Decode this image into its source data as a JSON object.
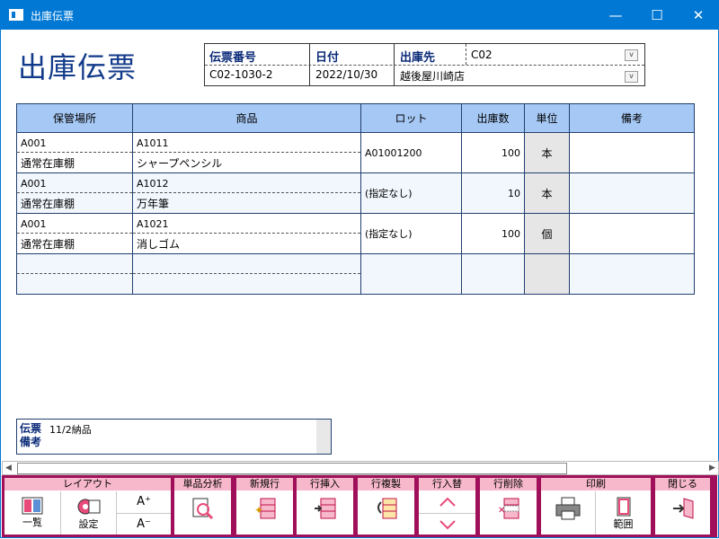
{
  "window": {
    "title": "出庫伝票",
    "minimize": "—",
    "maximize": "☐",
    "close": "✕"
  },
  "page_title": "出庫伝票",
  "header": {
    "slip_no_label": "伝票番号",
    "slip_no": "C02-1030-2",
    "date_label": "日付",
    "date": "2022/10/30",
    "dest_label": "出庫先",
    "dest_code": "C02",
    "dest_name": "越後屋川崎店"
  },
  "grid": {
    "columns": [
      "保管場所",
      "商品",
      "ロット",
      "出庫数",
      "単位",
      "備考"
    ],
    "rows": [
      {
        "loc_code": "A001",
        "loc_name": "通常在庫棚",
        "item_code": "A1011",
        "item_name": "シャープペンシル",
        "lot": "A01001200",
        "qty": "100",
        "unit": "本",
        "note": ""
      },
      {
        "loc_code": "A001",
        "loc_name": "通常在庫棚",
        "item_code": "A1012",
        "item_name": "万年筆",
        "lot": "(指定なし)",
        "qty": "10",
        "unit": "本",
        "note": ""
      },
      {
        "loc_code": "A001",
        "loc_name": "通常在庫棚",
        "item_code": "A1021",
        "item_name": "消しゴム",
        "lot": "(指定なし)",
        "qty": "100",
        "unit": "個",
        "note": ""
      }
    ]
  },
  "memo": {
    "label": "伝票備考",
    "value": "11/2納品"
  },
  "toolbar": {
    "layout": "レイアウト",
    "list": "一覧",
    "settings": "設定",
    "font_up": "A⁺",
    "font_down": "A⁻",
    "analysis": "単品分析",
    "new_row": "新規行",
    "insert_row": "行挿入",
    "copy_row": "行複製",
    "swap_row": "行入替",
    "delete_row": "行削除",
    "print": "印刷",
    "range": "範囲",
    "close": "閉じる"
  }
}
